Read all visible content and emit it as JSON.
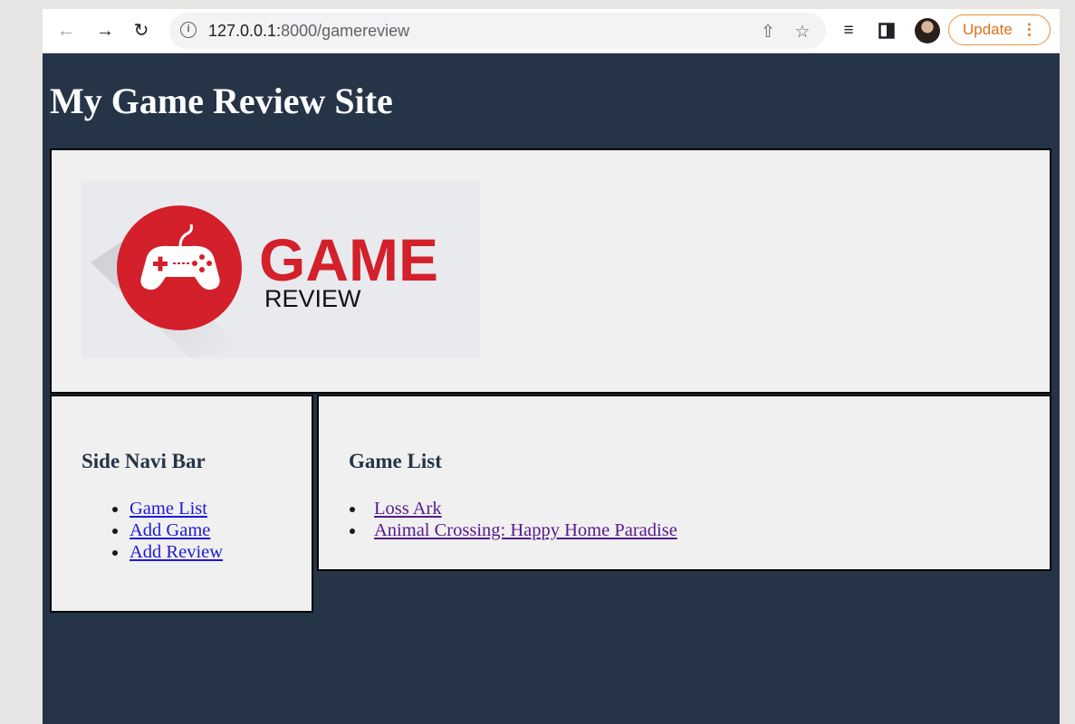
{
  "browser": {
    "url_host": "127.0.0.1:",
    "url_path": "8000/gamereview",
    "update_label": "Update",
    "icons": [
      "back-arrow-icon",
      "forward-arrow-icon",
      "reload-icon",
      "info-icon",
      "share-icon",
      "star-icon",
      "reading-list-icon",
      "side-panel-icon",
      "profile-avatar",
      "kebab-menu-icon"
    ],
    "update_color": "#e8913a"
  },
  "page": {
    "background": "#253447",
    "title": "My Game Review Site",
    "logo": {
      "title": "GAME",
      "subtitle": "REVIEW",
      "brand_color": "#d3202b"
    },
    "side_nav": {
      "heading": "Side Navi Bar",
      "items": [
        {
          "label": "Game List"
        },
        {
          "label": "Add Game"
        },
        {
          "label": "Add Review"
        }
      ]
    },
    "game_list": {
      "heading": "Game List",
      "items": [
        {
          "label": "Loss Ark"
        },
        {
          "label": "Animal Crossing: Happy Home Paradise"
        }
      ]
    }
  }
}
